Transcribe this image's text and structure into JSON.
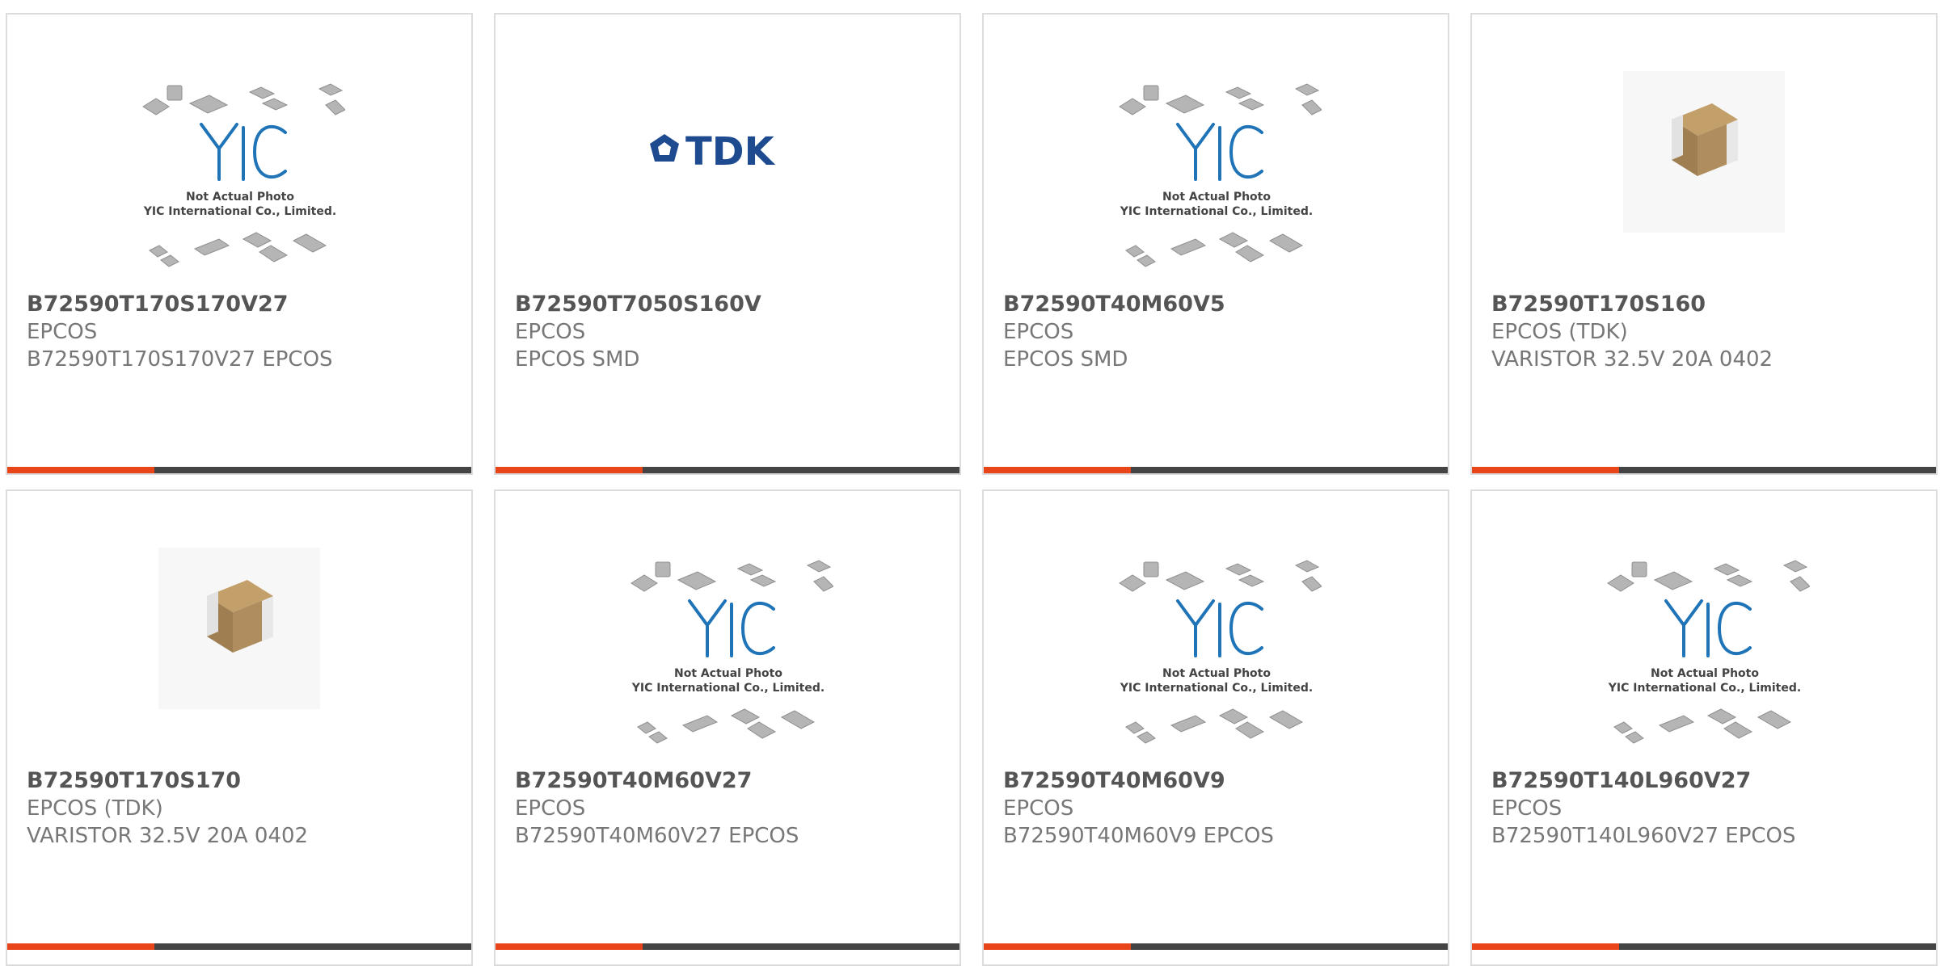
{
  "colors": {
    "accent": "#e8451b",
    "bar": "#444444",
    "yic_blue": "#1f73b7",
    "tdk_blue": "#1e4b8f"
  },
  "placeholder": {
    "line1": "Not Actual Photo",
    "line2": "YIC International Co., Limited."
  },
  "tdk_logo": "TDK",
  "products": [
    {
      "part": "B72590T170S170V27",
      "maker": "EPCOS",
      "desc": "B72590T170S170V27 EPCOS",
      "image": "yic-placeholder"
    },
    {
      "part": "B72590T7050S160V",
      "maker": "EPCOS",
      "desc": "EPCOS SMD",
      "image": "tdk-logo"
    },
    {
      "part": "B72590T40M60V5",
      "maker": "EPCOS",
      "desc": "EPCOS SMD",
      "image": "yic-placeholder"
    },
    {
      "part": "B72590T170S160",
      "maker": "EPCOS (TDK)",
      "desc": "VARISTOR 32.5V 20A 0402",
      "image": "chip-photo"
    },
    {
      "part": "B72590T170S170",
      "maker": "EPCOS (TDK)",
      "desc": "VARISTOR 32.5V 20A 0402",
      "image": "chip-photo"
    },
    {
      "part": "B72590T40M60V27",
      "maker": "EPCOS",
      "desc": "B72590T40M60V27 EPCOS",
      "image": "yic-placeholder"
    },
    {
      "part": "B72590T40M60V9",
      "maker": "EPCOS",
      "desc": "B72590T40M60V9 EPCOS",
      "image": "yic-placeholder"
    },
    {
      "part": "B72590T140L960V27",
      "maker": "EPCOS",
      "desc": "B72590T140L960V27 EPCOS",
      "image": "yic-placeholder"
    }
  ]
}
